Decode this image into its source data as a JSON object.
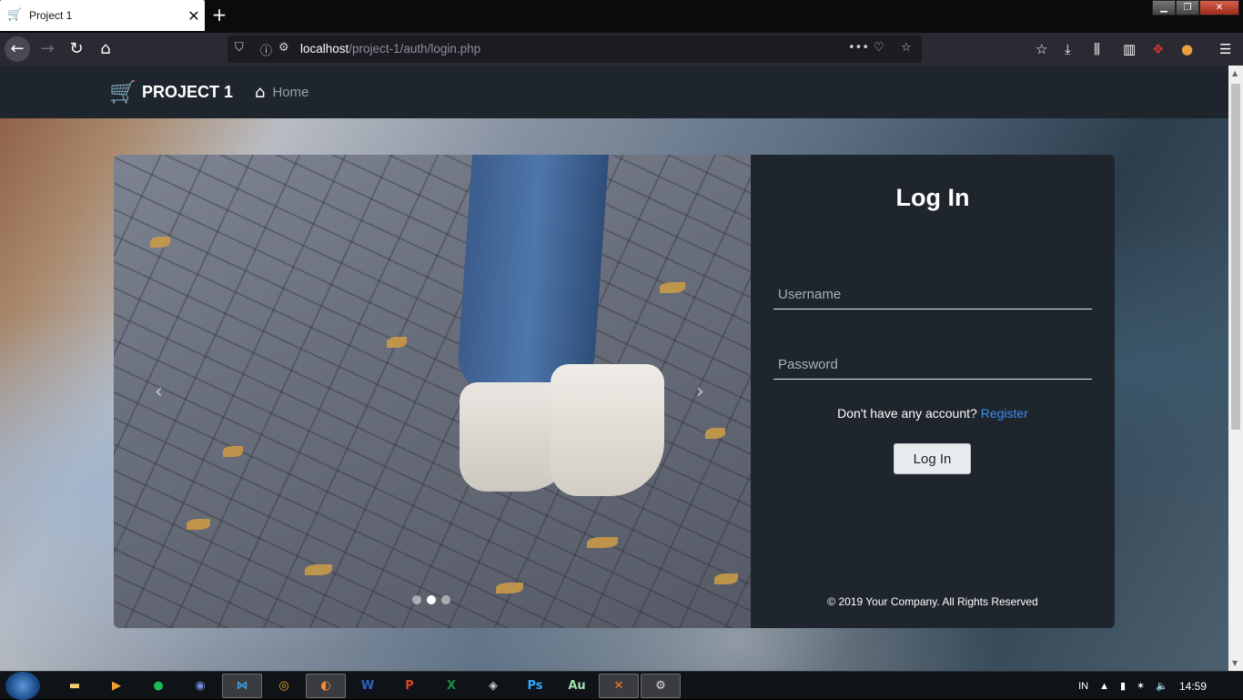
{
  "browser": {
    "tab_title": "Project 1",
    "url_host": "localhost",
    "url_path": "/project-1/auth/login.php"
  },
  "site": {
    "brand": "PROJECT 1",
    "nav_home": "Home"
  },
  "login": {
    "heading": "Log In",
    "username_placeholder": "Username",
    "password_placeholder": "Password",
    "register_prompt": "Don't have any account?",
    "register_link": "Register",
    "submit_label": "Log In",
    "footer": "© 2019 Your Company. All Rights Reserved"
  },
  "carousel": {
    "slide_count": 3,
    "active_slide": 2
  },
  "taskbar": {
    "language": "IN",
    "time": "14:59",
    "apps": [
      "explorer",
      "media-player",
      "spotify",
      "discord",
      "vscode",
      "chrome",
      "firefox",
      "word",
      "powerpoint",
      "excel",
      "inkscape",
      "photoshop",
      "audition",
      "xampp",
      "tool"
    ]
  },
  "colors": {
    "navbar_bg": "#1e252c",
    "link": "#3b8ded",
    "cart_icon": "#e43d3d"
  }
}
